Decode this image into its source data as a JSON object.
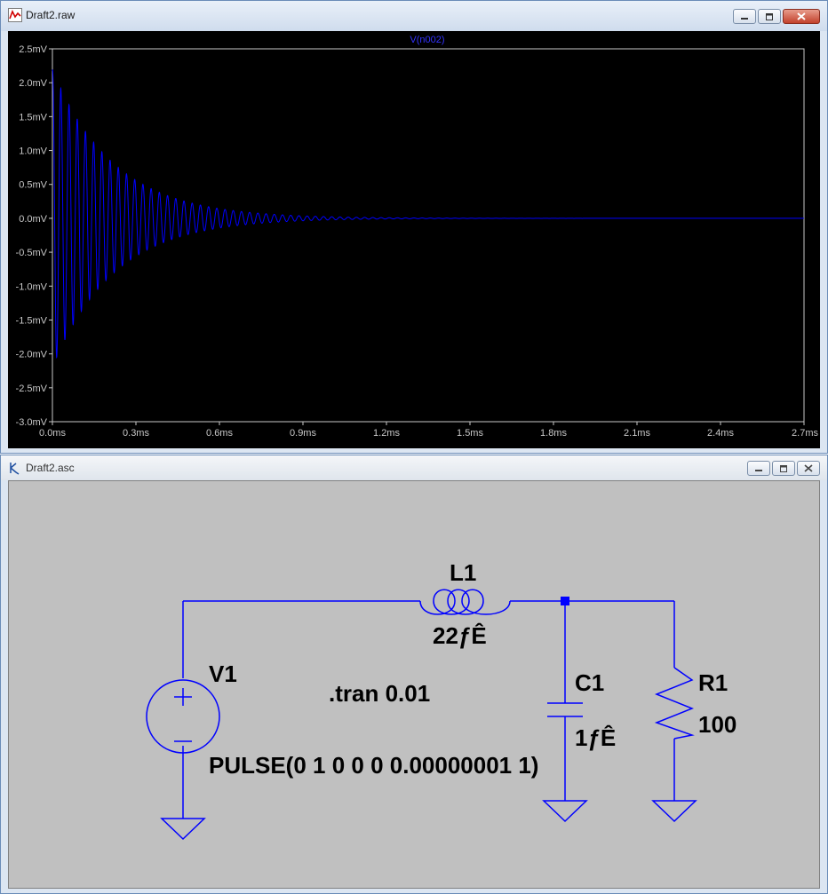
{
  "plot_window": {
    "title": "Draft2.raw",
    "trace_label": "V(n002)"
  },
  "schematic_window": {
    "title": "Draft2.asc"
  },
  "chart_data": {
    "type": "line",
    "title": "V(n002)",
    "xlabel": "",
    "ylabel": "",
    "x_unit": "ms",
    "y_unit": "mV",
    "xlim": [
      0,
      2.7
    ],
    "ylim": [
      -3.0,
      2.5
    ],
    "x_ticks": [
      "0.0ms",
      "0.3ms",
      "0.6ms",
      "0.9ms",
      "1.2ms",
      "1.5ms",
      "1.8ms",
      "2.1ms",
      "2.4ms",
      "2.7ms"
    ],
    "y_ticks": [
      "2.5mV",
      "2.0mV",
      "1.5mV",
      "1.0mV",
      "0.5mV",
      "0.0mV",
      "-0.5mV",
      "-1.0mV",
      "-1.5mV",
      "-2.0mV",
      "-2.5mV",
      "-3.0mV"
    ],
    "grid": false,
    "series": [
      {
        "name": "V(n002)",
        "color": "#0000ff",
        "shape": "damped-sine",
        "peak_mv": 2.2,
        "first_trough_mv": -2.1,
        "period_ms": 0.0295,
        "decay_ms": 0.22,
        "settles_to_mv": 0.0,
        "settled_by_ms": 1.2
      }
    ]
  },
  "components": {
    "L1": {
      "name": "L1",
      "value": "22ƒÊ"
    },
    "C1": {
      "name": "C1",
      "value": "1ƒÊ"
    },
    "R1": {
      "name": "R1",
      "value": "100"
    },
    "V1": {
      "name": "V1",
      "value": "PULSE(0 1 0 0 0 0.00000001 1)"
    },
    "directive": ".tran 0.01"
  },
  "colors": {
    "wire": "#0000ff",
    "plot_bg": "#000000",
    "schematic_bg": "#c0c0c0",
    "axis_text": "#c8c8c8"
  }
}
